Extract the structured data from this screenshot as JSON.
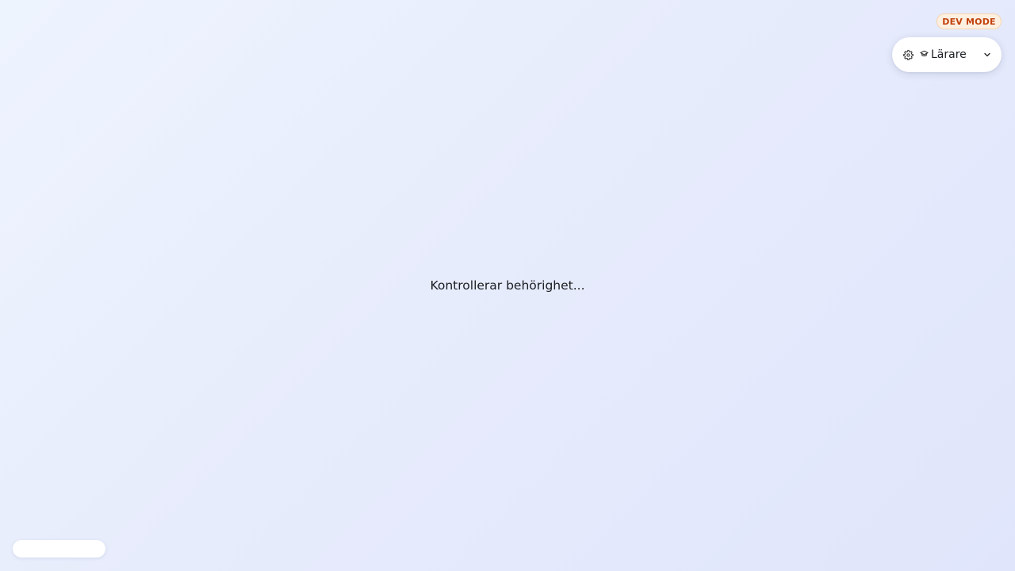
{
  "dev_badge": {
    "label": "DEV MODE",
    "color": "#c2410c",
    "background": "#fdf0e1"
  },
  "role_switcher": {
    "settings_icon": "gear-icon",
    "role_icon_glyph": "⛉",
    "role_icon": "graduation-cap-icon",
    "role_label": "Lärare",
    "dropdown_icon": "chevron-down-icon"
  },
  "main": {
    "status_text": "Kontrollerar behörighet..."
  }
}
